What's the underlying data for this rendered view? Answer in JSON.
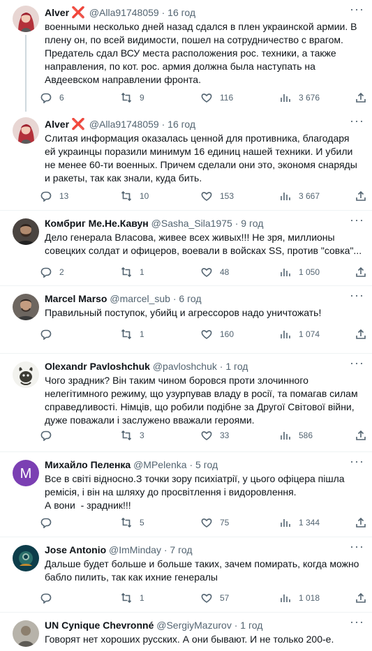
{
  "tweets": [
    {
      "name": "Alver",
      "verified_mark": "❌",
      "handle": "@Alla91748059",
      "time": "16 год",
      "text": "военными несколько дней назад сдался в плен украинской армии. В плену он, по всей видимости, пошел на сотрудничество с врагом. Предатель сдал ВСУ места расположения рос. техники, а также направления, по кот. рос. армия должна была наступать на Авдеевском направлении фронта.",
      "replies": "6",
      "retweets": "9",
      "likes": "116",
      "views": "3 676",
      "avatar_icon": "avatar-red-hair-woman"
    },
    {
      "name": "Alver",
      "verified_mark": "❌",
      "handle": "@Alla91748059",
      "time": "16 год",
      "text": "Слитая информация оказалась ценной для противника, благодаря ей украинцы поразили минимум 16 единиц нашей техники. И убили не менее 60-ти военных. Причем сделали они это, экономя снаряды и ракеты, так как знали, куда бить.",
      "replies": "13",
      "retweets": "10",
      "likes": "153",
      "views": "3 667",
      "avatar_icon": "avatar-red-hair-woman"
    },
    {
      "name": "Комбриг Ме.Не.Кавун",
      "handle": "@Sasha_Sila1975",
      "time": "9 год",
      "text": "Дело генерала Власова, живее всех живых!!! Не зря, миллионы совецких солдат и офицеров, воевали в войсках SS, против \"совка\"...",
      "replies": "2",
      "retweets": "1",
      "likes": "48",
      "views": "1 050",
      "avatar_icon": "avatar-bearded-man"
    },
    {
      "name": "Marcel Marso",
      "handle": "@marcel_sub",
      "time": "6 год",
      "text": "Правильный поступок, убийц и агрессоров надо уничтожать!",
      "replies": "",
      "retweets": "1",
      "likes": "160",
      "views": "1 074",
      "avatar_icon": "avatar-man-portrait"
    },
    {
      "name": "Olexandr Pavloshchuk",
      "handle": "@pavloshchuk",
      "time": "1 год",
      "text": "Чого зрадник? Він таким чином боровся проти злочинного нелегітимного режиму, що узурпував владу в росії, та помагав силам справедливості. Німців, що робили подібне за Другої Світової війни, дуже поважали і заслужено вважали героями.",
      "replies": "",
      "retweets": "3",
      "likes": "33",
      "views": "586",
      "avatar_icon": "avatar-cartoon-animal"
    },
    {
      "name": "Михайло Пеленка",
      "handle": "@MPelenka",
      "time": "5 год",
      "text": "Все в світі відносно.З точки зору психіатрії, у цього офіцера пішла ремісія, і він на шляху до просвітлення і видоровлення.\nА вони  - зрадник!!!",
      "replies": "",
      "retweets": "5",
      "likes": "75",
      "views": "1 344",
      "avatar_letter": "M",
      "avatar_color": "#7b3fb3"
    },
    {
      "name": "Jose Antonio",
      "handle": "@ImMinday",
      "time": "7 год",
      "text": "Дальше будет больше и больше таких, зачем помирать, когда можно бабло пилить, так как ихние генералы",
      "replies": "",
      "retweets": "1",
      "likes": "57",
      "views": "1 018",
      "avatar_icon": "avatar-diver"
    },
    {
      "name": "UN Cynique Chevronné",
      "handle": "@SergiyMazurov",
      "time": "1 год",
      "text": "Говорят нет хороших русских. А они бывают. И не только 200-е.",
      "avatar_icon": "avatar-person"
    }
  ],
  "separator": "·",
  "more_label": "···"
}
